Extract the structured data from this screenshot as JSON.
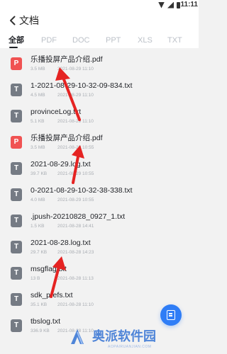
{
  "status_bar": {
    "time": "11:11"
  },
  "header": {
    "title": "文档"
  },
  "tabs": [
    {
      "label": "全部",
      "active": true
    },
    {
      "label": "PDF",
      "active": false
    },
    {
      "label": "DOC",
      "active": false
    },
    {
      "label": "PPT",
      "active": false
    },
    {
      "label": "XLS",
      "active": false
    },
    {
      "label": "TXT",
      "active": false
    }
  ],
  "files": [
    {
      "name": "乐播投屏产品介绍.pdf",
      "size": "3.5 MB",
      "date": "2021-08-29 11:10",
      "type": "pdf"
    },
    {
      "name": "1-2021-08-29-10-32-09-834.txt",
      "size": "4.5 MB",
      "date": "2021-08-29 11:10",
      "type": "txt"
    },
    {
      "name": "provinceLog.txt",
      "size": "5.1 KB",
      "date": "2021-08-29 11:10",
      "type": "txt"
    },
    {
      "name": "乐播投屏产品介绍.pdf",
      "size": "3.5 MB",
      "date": "2021-08-29 10:55",
      "type": "pdf"
    },
    {
      "name": "2021-08-29.log.txt",
      "size": "39.7 KB",
      "date": "2021-08-29 10:55",
      "type": "txt"
    },
    {
      "name": "0-2021-08-29-10-32-38-338.txt",
      "size": "4.0 MB",
      "date": "2021-08-29 10:55",
      "type": "txt"
    },
    {
      "name": ".jpush-20210828_0927_1.txt",
      "size": "1.5 KB",
      "date": "2021-08-28 14:41",
      "type": "txt"
    },
    {
      "name": "2021-08-28.log.txt",
      "size": "29.7 KB",
      "date": "2021-08-28 14:23",
      "type": "txt"
    },
    {
      "name": "msgflag.txt",
      "size": "13 B",
      "date": "2021-08-28 11:13",
      "type": "txt"
    },
    {
      "name": "sdk_prefs.txt",
      "size": "35.1 KB",
      "date": "2021-08-28 11:10",
      "type": "txt"
    },
    {
      "name": "tbslog.txt",
      "size": "336.9 KB",
      "date": "2021-08-28 11:10",
      "type": "txt"
    }
  ],
  "colors": {
    "pdf_icon": "#f05252",
    "txt_icon": "#757b84",
    "accent": "#2f7df6",
    "arrow": "#e52322",
    "watermark": "#4f85d8"
  },
  "watermark": {
    "text": "奥派软件园",
    "url": "AOPAIRUANJIAN.COM"
  }
}
